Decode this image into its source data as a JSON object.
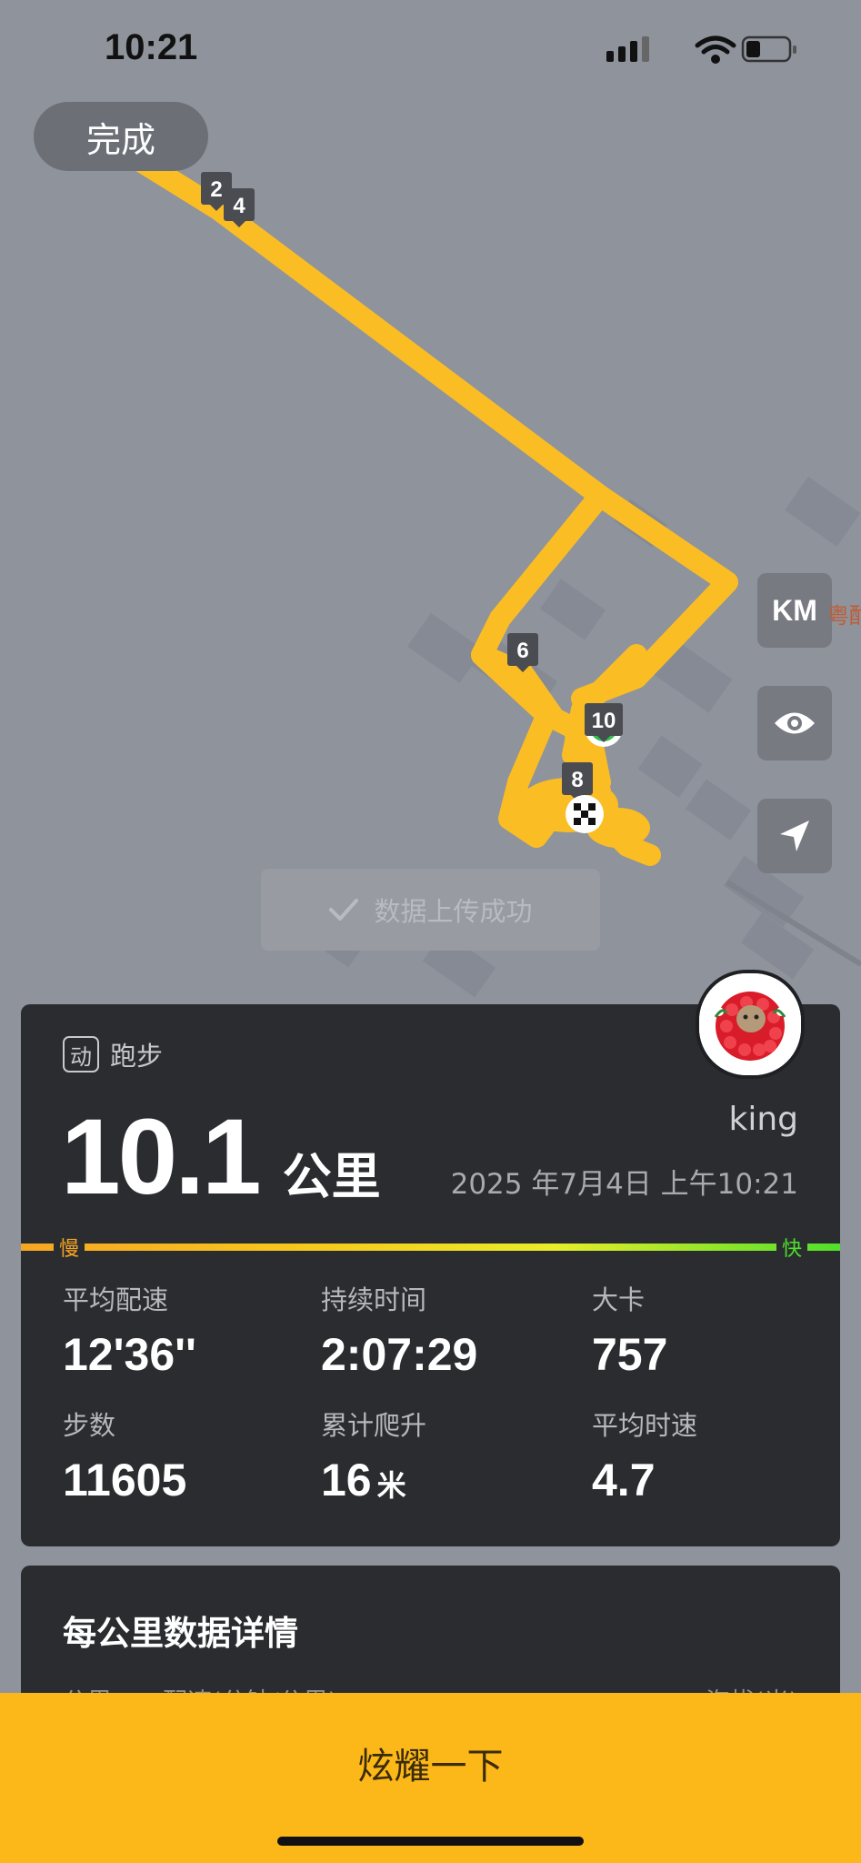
{
  "status_bar": {
    "time": "10:21"
  },
  "map": {
    "done_label": "完成",
    "km_markers": [
      "2",
      "4",
      "6",
      "8",
      "10"
    ],
    "km_button_label": "KM",
    "poi_label": "粤酣",
    "track_color": "#fbbd24"
  },
  "toast": {
    "text": "数据上传成功"
  },
  "summary": {
    "sport_icon_glyph": "动",
    "sport_type": "跑步",
    "distance_value": "10.1",
    "distance_unit": "公里",
    "username": "king",
    "datetime": "2025 年7月4日 上午10:21",
    "speed_slow_label": "慢",
    "speed_fast_label": "快",
    "stats": [
      {
        "label": "平均配速",
        "value": "12'36''",
        "unit": ""
      },
      {
        "label": "持续时间",
        "value": "2:07:29",
        "unit": ""
      },
      {
        "label": "大卡",
        "value": "757",
        "unit": ""
      },
      {
        "label": "步数",
        "value": "11605",
        "unit": ""
      },
      {
        "label": "累计爬升",
        "value": "16",
        "unit": "米"
      },
      {
        "label": "平均时速",
        "value": "4.7",
        "unit": ""
      }
    ]
  },
  "details": {
    "title": "每公里数据详情",
    "col_km": "公里",
    "col_pace": "配速(分钟/公里)",
    "col_altitude": "海拔(米)"
  },
  "bottom": {
    "share_label": "炫耀一下"
  },
  "colors": {
    "accent": "#fcb719",
    "card_bg": "#2b2c30",
    "slow": "#f5a623",
    "fast": "#4fe02a"
  }
}
